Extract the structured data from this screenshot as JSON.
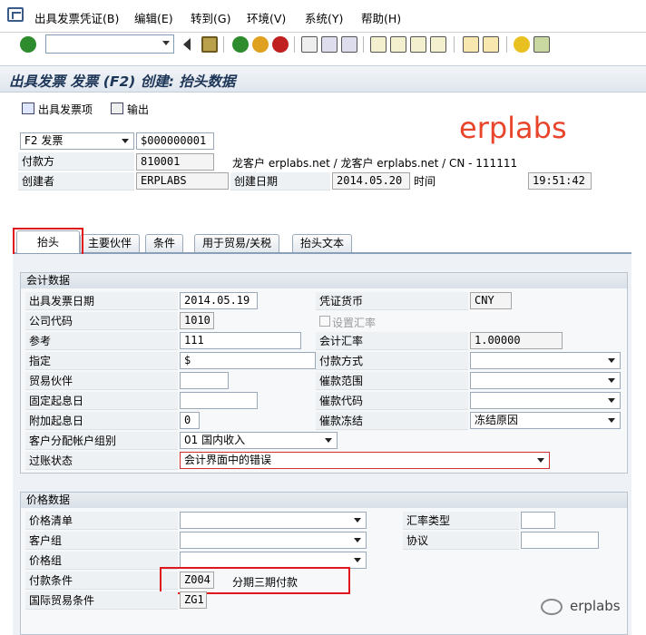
{
  "menu": {
    "items": [
      "出具发票凭证(B)",
      "编辑(E)",
      "转到(G)",
      "环境(V)",
      "系统(Y)",
      "帮助(H)"
    ]
  },
  "title": "出具发票 发票 (F2) 创建: 抬头数据",
  "appbar": {
    "items": [
      "出具发票项",
      "输出"
    ]
  },
  "watermark": "erplabs",
  "header": {
    "doc_type": "F2 发票",
    "doc_number": "$000000001",
    "payer_label": "付款方",
    "payer_value": "810001",
    "payer_desc": "龙客户 erplabs.net / 龙客户 erplabs.net / CN - 111111",
    "creator_label": "创建者",
    "creator_value": "ERPLABS",
    "created_on_label": "创建日期",
    "created_on_value": "2014.05.20",
    "time_label": "时间",
    "time_value": "19:51:42"
  },
  "tabs": [
    "抬头",
    "主要伙伴",
    "条件",
    "用于贸易/关税",
    "抬头文本"
  ],
  "accounting": {
    "title": "会计数据",
    "billing_date_label": "出具发票日期",
    "billing_date": "2014.05.19",
    "doc_currency_label": "凭证货币",
    "doc_currency": "CNY",
    "company_code_label": "公司代码",
    "company_code": "1010",
    "set_rate_label": "设置汇率",
    "reference_label": "参考",
    "reference": "111",
    "exch_rate_label": "会计汇率",
    "exch_rate": "1.00000",
    "assignment_label": "指定",
    "assignment": "$",
    "payment_method_label": "付款方式",
    "trading_partner_label": "贸易伙伴",
    "dunning_area_label": "催款范围",
    "fixed_date_label": "固定起息日",
    "dunning_key_label": "催款代码",
    "add_days_label": "附加起息日",
    "add_days": "0",
    "dunning_block_label": "催款冻结",
    "dunning_block": "冻结原因",
    "acct_group_label": "客户分配帐户组别",
    "acct_group": "01 国内收入",
    "posting_status_label": "过账状态",
    "posting_status": "会计界面中的错误"
  },
  "pricing": {
    "title": "价格数据",
    "price_list_label": "价格清单",
    "exch_type_label": "汇率类型",
    "cust_group_label": "客户组",
    "agreement_label": "协议",
    "price_group_label": "价格组",
    "payment_terms_label": "付款条件",
    "payment_terms": "Z004",
    "payment_terms_desc": "分期三期付款",
    "incoterms_label": "国际贸易条件",
    "incoterms": "ZG1"
  },
  "footer": {
    "wechat": "erplabs"
  },
  "colors": {
    "highlight": "#e0161b",
    "watermark": "#e8452b"
  }
}
